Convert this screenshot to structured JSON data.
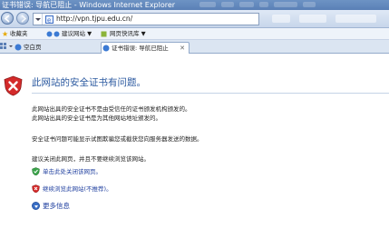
{
  "window": {
    "title": "证书错误: 导航已阻止 - Windows Internet Explorer"
  },
  "navbar": {
    "back_icon": "back-arrow-icon",
    "forward_icon": "forward-arrow-icon",
    "address_url": "http://vpn.tjpu.edu.cn/"
  },
  "favorites": {
    "favorites_label": "收藏夹",
    "suggested_sites_label": "建议网站 ▼",
    "web_slice_label": "网页快讯库 ▼"
  },
  "tabs": [
    {
      "label": "空白页"
    },
    {
      "label": "证书错误: 导航已阻止"
    }
  ],
  "content": {
    "heading": "此网站的安全证书有问题。",
    "para1_line1": "此网站出具的安全证书不是由受信任的证书颁发机构颁发的。",
    "para1_line2": "此网站出具的安全证书是为其他网站地址颁发的。",
    "para2": "安全证书问题可能显示试图欺骗您或截获您向服务器发送的数据。",
    "para3": "建议关闭此网页，并且不要继续浏览该网站。",
    "option_close": "单击此处关闭该网页。",
    "option_continue": "继续浏览此网站(不推荐)。",
    "more_info": "更多信息"
  },
  "colors": {
    "heading": "#2c5aa0",
    "link": "#1f3f9f",
    "shield_red": "#d42a2a"
  }
}
